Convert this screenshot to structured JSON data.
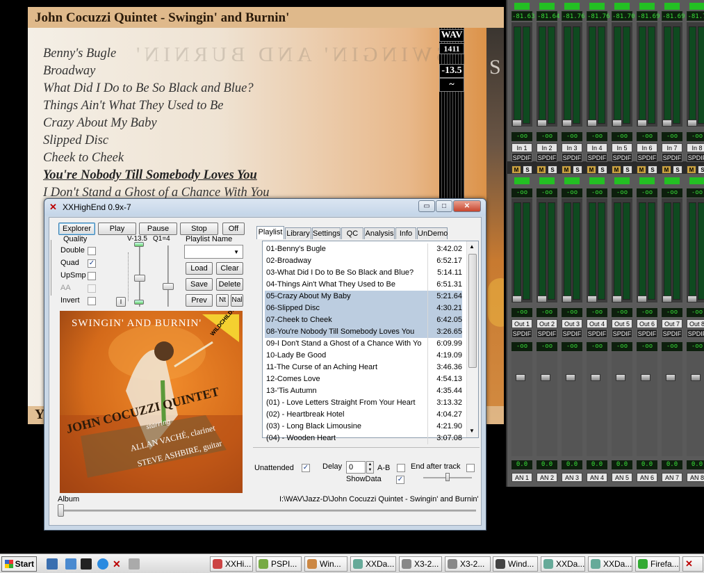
{
  "big_window": {
    "title": "John Cocuzzi Quintet - Swingin' and Burnin'",
    "tracks": [
      "Benny's Bugle",
      "Broadway",
      "What Did I Do to Be So Black and Blue?",
      "Things Ain't What They Used to Be",
      "Crazy About My Baby",
      "Slipped Disc",
      "Cheek to Cheek",
      "You're Nobody Till Somebody Loves You",
      "I Don't Stand a Ghost of a Chance With You"
    ],
    "current_index": 7,
    "format": "WAV",
    "bitrate": "1411",
    "volume": "-13.5",
    "tilde": "~",
    "bottom_letter": "Y"
  },
  "mixer": {
    "channels": [
      {
        "peak": "-81.63",
        "in": "In 1",
        "out": "Out 1",
        "an": "AN 1"
      },
      {
        "peak": "-81.64",
        "in": "In 2",
        "out": "Out 2",
        "an": "AN 2"
      },
      {
        "peak": "-81.76",
        "in": "In 3",
        "out": "Out 3",
        "an": "AN 3"
      },
      {
        "peak": "-81.76",
        "in": "In 4",
        "out": "Out 4",
        "an": "AN 4"
      },
      {
        "peak": "-81.70",
        "in": "In 5",
        "out": "Out 5",
        "an": "AN 5"
      },
      {
        "peak": "-81.69",
        "in": "In 6",
        "out": "Out 6",
        "an": "AN 6"
      },
      {
        "peak": "-81.69",
        "in": "In 7",
        "out": "Out 7",
        "an": "AN 7"
      },
      {
        "peak": "-81.7",
        "in": "In 8",
        "out": "Out 8",
        "an": "AN 8"
      }
    ],
    "inf_label": "-oo",
    "spdif_label": "SPDIF",
    "m_label": "M",
    "s_label": "S",
    "zero_label": "0.0"
  },
  "app": {
    "title": "XXHighEnd 0.9x-7",
    "window_buttons": {
      "minimize": "▭",
      "maximize": "□",
      "close": "✕"
    },
    "buttons": {
      "explorer": "Explorer",
      "play": "Play",
      "pause": "Pause",
      "stop": "Stop",
      "off": "Off",
      "load": "Load",
      "clear": "Clear",
      "save": "Save",
      "delete": "Delete",
      "prev": "Prev",
      "nt": "Nt",
      "nal": "Nal",
      "i": "I"
    },
    "quality": {
      "group_label": "Quality",
      "options": [
        {
          "label": "Double",
          "checked": false,
          "enabled": true
        },
        {
          "label": "Quad",
          "checked": true,
          "enabled": true
        },
        {
          "label": "UpSmp",
          "checked": false,
          "enabled": true
        },
        {
          "label": "AA",
          "checked": false,
          "enabled": false
        },
        {
          "label": "Invert",
          "checked": false,
          "enabled": true
        }
      ]
    },
    "volume_label": "V-13.5",
    "q1_label": "Q1=4",
    "playlist_name_label": "Playlist Name",
    "tabs": [
      "Playlist",
      "Library",
      "Settings",
      "QC",
      "Analysis",
      "Info",
      "UnDemo"
    ],
    "selected_tab": 0,
    "playlist": [
      {
        "name": "01-Benny's Bugle",
        "dur": "3:42.02",
        "sel": false
      },
      {
        "name": "02-Broadway",
        "dur": "6:52.17",
        "sel": false
      },
      {
        "name": "03-What Did I Do to Be So Black and Blue?",
        "dur": "5:14.11",
        "sel": false
      },
      {
        "name": "04-Things Ain't What They Used to Be",
        "dur": "6:51.31",
        "sel": false
      },
      {
        "name": "05-Crazy About My Baby",
        "dur": "5:21.64",
        "sel": true
      },
      {
        "name": "06-Slipped Disc",
        "dur": "4:30.21",
        "sel": true
      },
      {
        "name": "07-Cheek to Cheek",
        "dur": "6:42.05",
        "sel": true
      },
      {
        "name": "08-You're Nobody Till Somebody Loves You",
        "dur": "3:26.65",
        "sel": true
      },
      {
        "name": "09-I Don't Stand a Ghost of a Chance With Yo",
        "dur": "6:09.99",
        "sel": false
      },
      {
        "name": "10-Lady Be Good",
        "dur": "4:19.09",
        "sel": false
      },
      {
        "name": "11-The Curse of an Aching Heart",
        "dur": "3:46.36",
        "sel": false
      },
      {
        "name": "12-Comes Love",
        "dur": "4:54.13",
        "sel": false
      },
      {
        "name": "13-'Tis Autumn",
        "dur": "4:35.44",
        "sel": false
      },
      {
        "name": "(01) - Love Letters Straight From Your Heart",
        "dur": "3:13.32",
        "sel": false
      },
      {
        "name": "(02) - Heartbreak Hotel",
        "dur": "4:04.27",
        "sel": false
      },
      {
        "name": "(03) - Long Black Limousine",
        "dur": "4:21.90",
        "sel": false
      },
      {
        "name": "(04) - Wooden Heart",
        "dur": "3:07.08",
        "sel": false
      }
    ],
    "options": {
      "unattended_label": "Unattended",
      "unattended": true,
      "delay_label": "Delay",
      "delay_value": "0",
      "ab_label": "A-B",
      "ab": false,
      "end_after_track_label": "End after track",
      "end_after_track": false,
      "showdata_label": "ShowData",
      "showdata": true
    },
    "album_label": "Album",
    "path": "I:\\WAV\\Jazz-D\\John Cocuzzi Quintet - Swingin' and Burnin'",
    "album_art": {
      "top_text": "SWINGIN' AND BURNIN'",
      "band": "JOHN COCUZZI QUINTET",
      "starring": "starring",
      "artist1": "ALLAN VACHÉ, clarinet",
      "artist2": "STEVE ASHBIRE, guitar",
      "label": "WILDCHILD!"
    }
  },
  "taskbar": {
    "start": "Start",
    "items": [
      "XXHi...",
      "PSPI...",
      "Win...",
      "XXDa...",
      "X3-2...",
      "X3-2...",
      "Wind...",
      "XXDa...",
      "XXDa...",
      "Firefa..."
    ]
  }
}
